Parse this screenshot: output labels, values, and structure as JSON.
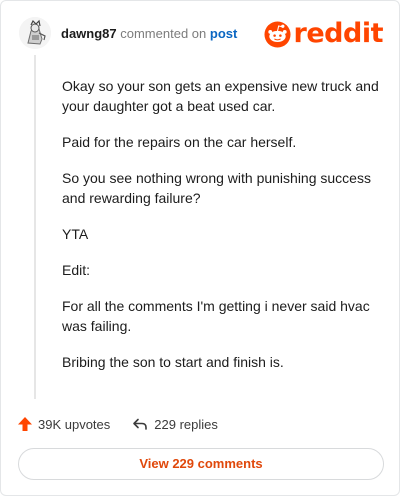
{
  "header": {
    "username": "dawng87",
    "commented_on": "commented on",
    "post_link": "post",
    "logo_text": "reddit",
    "brand_color": "#ff4500"
  },
  "comment": {
    "paragraphs": [
      "Okay so your son gets an expensive new truck and your daughter got a beat used car.",
      "Paid for the repairs on the car herself.",
      "So you see nothing wrong with punishing success and rewarding failure?",
      "YTA",
      "Edit:",
      "For all the comments I'm getting i never said hvac was failing.",
      "Bribing the son to start and finish is."
    ]
  },
  "actions": {
    "upvotes": "39K upvotes",
    "replies": "229 replies",
    "view_comments": "View 229 comments"
  },
  "icons": {
    "avatar": "avatar-icon",
    "logo": "reddit-snoo-icon",
    "upvote": "upvote-arrow-icon",
    "reply": "reply-arrow-icon"
  }
}
